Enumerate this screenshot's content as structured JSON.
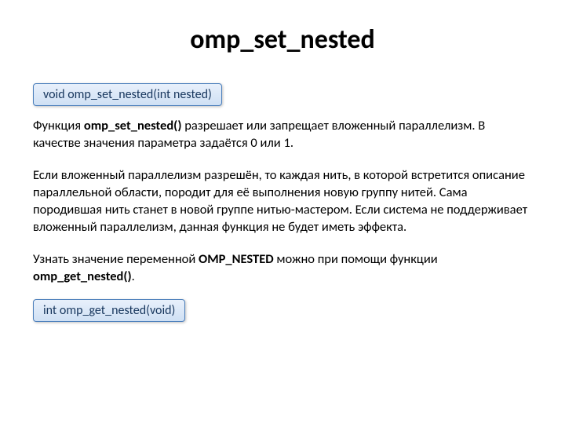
{
  "title": "omp_set_nested",
  "signature_set": "void omp_set_nested(int nested)",
  "para1_pre": "Функция ",
  "para1_fn": "omp_set_nested()",
  "para1_post": " разрешает или запрещает вложенный параллелизм. В качестве значения параметра задаётся 0 или 1.",
  "para2": "Если вложенный параллелизм разрешён, то каждая нить, в которой встретится описание параллельной области, породит для её выполнения новую группу нитей. Сама породившая нить станет в новой группе нитью-мастером. Если система не поддерживает вложенный параллелизм, данная функция не будет иметь эффекта.",
  "para3_pre": "Узнать значение переменной ",
  "para3_var": "OMP_NESTED",
  "para3_mid": " можно при помощи функции ",
  "para3_fn": "omp_get_nested()",
  "para3_post": ".",
  "signature_get": "int omp_get_nested(void)"
}
